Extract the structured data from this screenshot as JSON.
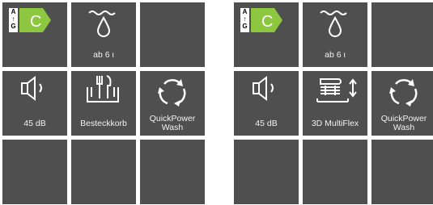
{
  "panels": [
    {
      "tiles": [
        {
          "icon": "energy-class-icon",
          "label": "",
          "energy": {
            "scale_top": "A",
            "scale_bottom": "G",
            "class": "C",
            "color": "#8dc63f"
          }
        },
        {
          "icon": "water-drop-icon",
          "label": "ab 6 ι"
        },
        {
          "icon": "",
          "label": ""
        },
        {
          "icon": "speaker-icon",
          "label": "45 dB"
        },
        {
          "icon": "cutlery-basket-icon",
          "label": "Besteckkorb"
        },
        {
          "icon": "quickpower-wash-icon",
          "label": "QuickPower Wash"
        },
        {
          "icon": "",
          "label": ""
        },
        {
          "icon": "",
          "label": ""
        },
        {
          "icon": "",
          "label": ""
        }
      ]
    },
    {
      "tiles": [
        {
          "icon": "energy-class-icon",
          "label": "",
          "energy": {
            "scale_top": "A",
            "scale_bottom": "G",
            "class": "C",
            "color": "#8dc63f"
          }
        },
        {
          "icon": "water-drop-icon",
          "label": "ab 6 ι"
        },
        {
          "icon": "",
          "label": ""
        },
        {
          "icon": "speaker-icon",
          "label": "45 dB"
        },
        {
          "icon": "multiflex-tray-icon",
          "label": "3D MultiFlex"
        },
        {
          "icon": "quickpower-wash-icon",
          "label": "QuickPower Wash"
        },
        {
          "icon": "",
          "label": ""
        },
        {
          "icon": "",
          "label": ""
        },
        {
          "icon": "",
          "label": ""
        }
      ]
    }
  ],
  "captions": {
    "quickpower_line1": "QuickPower",
    "quickpower_line2": "Wash"
  }
}
